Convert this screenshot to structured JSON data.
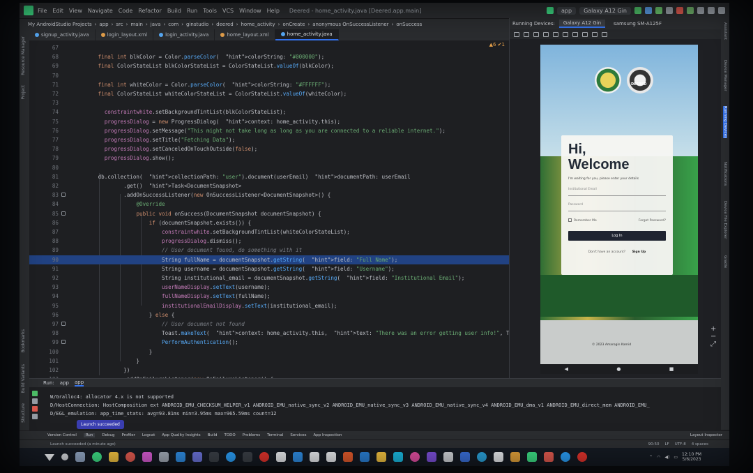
{
  "menu": [
    "File",
    "Edit",
    "View",
    "Navigate",
    "Code",
    "Refactor",
    "Build",
    "Run",
    "Tools",
    "VCS",
    "Window",
    "Help"
  ],
  "window_title": "Deered - home_activity.java [Deered.app.main]",
  "toolbar": {
    "config": "app",
    "device": "Galaxy A12 Gin"
  },
  "breadcrumb": [
    "My AndroidStudio Projects",
    "app",
    "src",
    "main",
    "java",
    "com",
    "ginstudio",
    "deered",
    "home_activity",
    "onCreate",
    "anonymous OnSuccessListener",
    "onSuccess"
  ],
  "tabs": [
    "signup_activity.java",
    "login_layout.xml",
    "login_activity.java",
    "home_layout.xml",
    "home_activity.java"
  ],
  "editor_warnings": "▲6 ✔1",
  "code": [
    {
      "n": "67",
      "t": ""
    },
    {
      "n": "68",
      "t": "        final int blkColor = Color.parseColor(  colorString: \"#000000\");"
    },
    {
      "n": "69",
      "t": "        final ColorStateList blkColorStateList = ColorStateList.valueOf(blkColor);"
    },
    {
      "n": "70",
      "t": ""
    },
    {
      "n": "71",
      "t": "        final int whiteColor = Color.parseColor(  colorString: \"#FFFFFF\");"
    },
    {
      "n": "72",
      "t": "        final ColorStateList whiteColorStateList = ColorStateList.valueOf(whiteColor);"
    },
    {
      "n": "73",
      "t": ""
    },
    {
      "n": "74",
      "t": "          constraintwhite.setBackgroundTintList(blkColorStateList);"
    },
    {
      "n": "75",
      "t": "          progressDialog = new ProgressDialog(  context: home_activity.this);"
    },
    {
      "n": "76",
      "t": "          progressDialog.setMessage(\"This might not take long as long as you are connected to a reliable internet.\");"
    },
    {
      "n": "77",
      "t": "          progressDialog.setTitle(\"Fetching Data\");"
    },
    {
      "n": "78",
      "t": "          progressDialog.setCanceledOnTouchOutside(false);"
    },
    {
      "n": "79",
      "t": "          progressDialog.show();"
    },
    {
      "n": "80",
      "t": ""
    },
    {
      "n": "81",
      "t": "        db.collection(  collectionPath: \"user\").document(userEmail)  documentPath: userEmail"
    },
    {
      "n": "82",
      "t": "                .get()  Task<DocumentSnapshot>"
    },
    {
      "n": "83",
      "t": "                .addOnSuccessListener(new OnSuccessListener<DocumentSnapshot>() {"
    },
    {
      "n": "84",
      "t": "                    @Override"
    },
    {
      "n": "85",
      "t": "                    public void onSuccess(DocumentSnapshot documentSnapshot) {"
    },
    {
      "n": "86",
      "t": "                        if (documentSnapshot.exists()) {"
    },
    {
      "n": "87",
      "t": "                            constraintwhite.setBackgroundTintList(whiteColorStateList);"
    },
    {
      "n": "88",
      "t": "                            progressDialog.dismiss();"
    },
    {
      "n": "89",
      "t": "                            // User document found, do something with it"
    },
    {
      "n": "90",
      "t": "                            String fullName = documentSnapshot.getString(  field: \"Full Name\");"
    },
    {
      "n": "91",
      "t": "                            String username = documentSnapshot.getString(  field: \"Username\");"
    },
    {
      "n": "92",
      "t": "                            String institutional_email = documentSnapshot.getString(  field: \"Institutional Email\");"
    },
    {
      "n": "93",
      "t": "                            userNameDisplay.setText(username);"
    },
    {
      "n": "94",
      "t": "                            fullNameDisplay.setText(fullName);"
    },
    {
      "n": "95",
      "t": "                            institutionalEmailDisplay.setText(institutional_email);"
    },
    {
      "n": "96",
      "t": "                        } else {"
    },
    {
      "n": "97",
      "t": "                            // User document not found"
    },
    {
      "n": "98",
      "t": "                            Toast.makeText(  context: home_activity.this,  text: \"There was an error getting user info!\", Toast.LENGTH_SHORT)."
    },
    {
      "n": "99",
      "t": "                            PerformAuthentication();"
    },
    {
      "n": "100",
      "t": "                        }"
    },
    {
      "n": "101",
      "t": "                    }"
    },
    {
      "n": "102",
      "t": "                })"
    },
    {
      "n": "103",
      "t": "                .addOnFailureListener(new OnFailureListener() {"
    },
    {
      "n": "104",
      "t": "                    @Override"
    }
  ],
  "selected_line": "90",
  "running_devices": {
    "label": "Running Devices:",
    "tabs": [
      "Galaxy A12 Gin",
      "samsung SM-A125F"
    ]
  },
  "phone": {
    "hi": "Hi,",
    "welcome": "Welcome",
    "subtitle": "I'm waiting for you, please enter your details",
    "email_placeholder": "Institutional Email",
    "password_placeholder": "Password",
    "remember": "Remember Me",
    "forgot": "Forgot Password?",
    "login": "Log In",
    "no_account": "Don't have an account?",
    "signup": "Sign Up",
    "copyright": "© 2023 Amarogin Kamid",
    "seal_text": "DEERED"
  },
  "run": {
    "label": "Run:",
    "tabs": [
      "app",
      "app"
    ],
    "log": [
      "W/Gralloc4: allocator 4.x is not supported",
      "D/HostConnection: HostComposition ext ANDROID_EMU_CHECKSUM_HELPER_v1 ANDROID_EMU_native_sync_v2 ANDROID_EMU_native_sync_v3 ANDROID_EMU_native_sync_v4 ANDROID_EMU_dma_v1 ANDROID_EMU_direct_mem ANDROID_EMU_",
      "D/EGL_emulation: app_time_stats: avg=93.81ms min=3.95ms max=965.59ms count=12"
    ],
    "toast": "Launch succeeded"
  },
  "toolwindows": [
    "Version Control",
    "Run",
    "Debug",
    "Profiler",
    "Logcat",
    "App Quality Insights",
    "Build",
    "TODO",
    "Problems",
    "Terminal",
    "Services",
    "App Inspection"
  ],
  "layout_inspector": "Layout Inspector",
  "status": {
    "message": "Launch succeeded (a minute ago)",
    "pos": "90:50",
    "lf": "LF",
    "enc": "UTF-8",
    "indent": "4 spaces"
  },
  "clock": {
    "time": "12:10 PM",
    "date": "5/6/2023"
  },
  "side_labels": {
    "left": [
      "Resource Manager",
      "Project",
      "Bookmarks",
      "Build Variants",
      "Structure"
    ],
    "right": [
      "Assistant",
      "Device Manager",
      "Running Devices",
      "Notifications",
      "Device File Explorer",
      "Gradle"
    ]
  }
}
